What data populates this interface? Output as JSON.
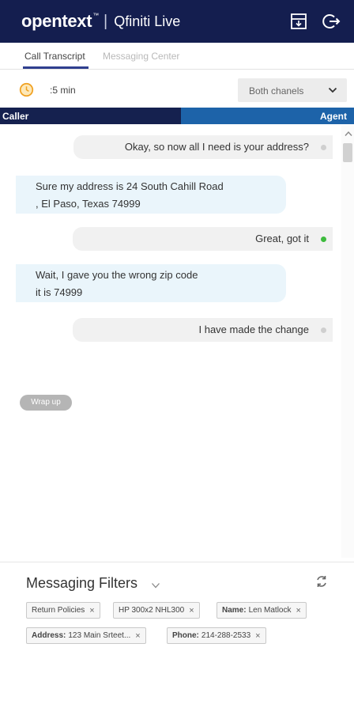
{
  "header": {
    "brand": "opentext",
    "brand_mark": "™",
    "separator": "|",
    "product": "Qfiniti Live",
    "icons": [
      "panel-download-icon",
      "logout-icon"
    ]
  },
  "tabs": [
    {
      "label": "Call Transcript",
      "active": true
    },
    {
      "label": "Messaging Center",
      "active": false
    }
  ],
  "controls": {
    "duration": ":5 min",
    "channel_select": "Both chanels"
  },
  "channels": {
    "caller": "Caller",
    "agent": "Agent"
  },
  "messages": [
    {
      "speaker": "agent",
      "text": "Okay, so now all I need is your address?",
      "status": "gray"
    },
    {
      "speaker": "caller",
      "lines": [
        "Sure my address is 24 South Cahill Road",
        ", El Paso, Texas 74999"
      ],
      "status": "green"
    },
    {
      "speaker": "agent",
      "text": "Great, got it",
      "status": "green"
    },
    {
      "speaker": "caller",
      "lines": [
        "Wait, I gave you the wrong zip code",
        "it is 74999"
      ],
      "status": "red"
    },
    {
      "speaker": "agent",
      "text": "I have made the change",
      "status": "gray"
    }
  ],
  "wrap_up_label": "Wrap up",
  "filters": {
    "title": "Messaging Filters",
    "chips": [
      {
        "key": "",
        "value": "Return Policies"
      },
      {
        "key": "",
        "value": "HP 300x2 NHL300"
      },
      {
        "key": "Name:",
        "value": "Len Matlock"
      },
      {
        "key": "Address:",
        "value": "123 Main Srteet..."
      },
      {
        "key": "Phone:",
        "value": "214-288-2533"
      }
    ],
    "chip_close": "×"
  },
  "colors": {
    "header_bg": "#141e4f",
    "caller_bar": "#15214f",
    "agent_bar": "#1d63a9",
    "tab_accent": "#2f3f8f",
    "status_green": "#3dbb3d",
    "status_red": "#e8532e",
    "status_gray": "#cfcfcf",
    "clock_orange": "#f0a020"
  }
}
